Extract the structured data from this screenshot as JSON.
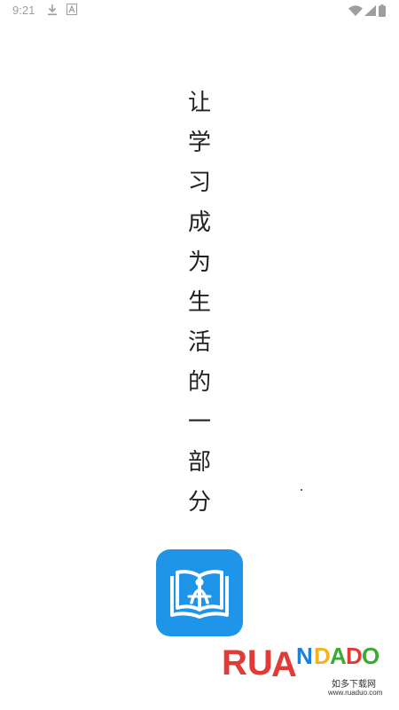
{
  "status_bar": {
    "time": "9:21",
    "icons": [
      "download-icon",
      "a-icon",
      "wifi-icon",
      "signal-icon",
      "battery-icon"
    ],
    "color": "#9e9e9e"
  },
  "slogan": {
    "characters": [
      "让",
      "学",
      "习",
      "成",
      "为",
      "生",
      "活",
      "的",
      "一",
      "部",
      "分"
    ]
  },
  "app_logo": {
    "icon": "open-book-icon",
    "color": "#1f95ea"
  },
  "watermark": {
    "logo_text": "RUANDADO",
    "tagline": "如多下载网",
    "url": "www.ruaduo.com",
    "colors": {
      "red": "#e23a35",
      "blue": "#1d7fd8",
      "green": "#3aaa35",
      "yellow": "#f2b41c"
    }
  }
}
